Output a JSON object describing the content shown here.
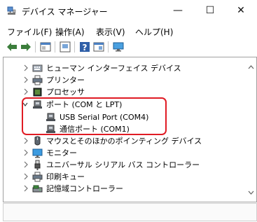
{
  "window": {
    "title": "デバイス マネージャー",
    "controls": {
      "minimize": "—",
      "maximize": "☐",
      "close": "✕"
    }
  },
  "menu": {
    "items": [
      "ファイル(F)",
      "操作(A)",
      "表示(V)",
      "ヘルプ(H)"
    ]
  },
  "toolbar": {
    "icons": [
      "back-arrow-icon",
      "forward-arrow-icon",
      "properties-icon",
      "device-icon",
      "help-icon",
      "show-device-icon",
      "monitor-icon"
    ]
  },
  "tree": {
    "items": [
      {
        "label": "ヒューマン インターフェイス デバイス",
        "icon": "hid-icon",
        "expanded": false
      },
      {
        "label": "プリンター",
        "icon": "printer-icon",
        "expanded": false
      },
      {
        "label": "プロセッサ",
        "icon": "processor-icon",
        "expanded": false
      },
      {
        "label": "ポート (COM と LPT)",
        "icon": "port-icon",
        "expanded": true
      },
      {
        "label": "USB Serial Port (COM4)",
        "icon": "port-icon",
        "child": true
      },
      {
        "label": "通信ポート (COM1)",
        "icon": "port-icon",
        "child": true
      },
      {
        "label": "マウスとそのほかのポインティング デバイス",
        "icon": "mouse-icon",
        "expanded": false
      },
      {
        "label": "モニター",
        "icon": "monitor-icon",
        "expanded": false
      },
      {
        "label": "ユニバーサル シリアル バス コントローラー",
        "icon": "usb-icon",
        "expanded": false
      },
      {
        "label": "印刷キュー",
        "icon": "print-queue-icon",
        "expanded": false
      },
      {
        "label": "記憶域コントローラー",
        "icon": "storage-icon",
        "expanded": false
      }
    ]
  },
  "colors": {
    "highlight": "#e01b24",
    "selection_accent": "#0078d7"
  }
}
